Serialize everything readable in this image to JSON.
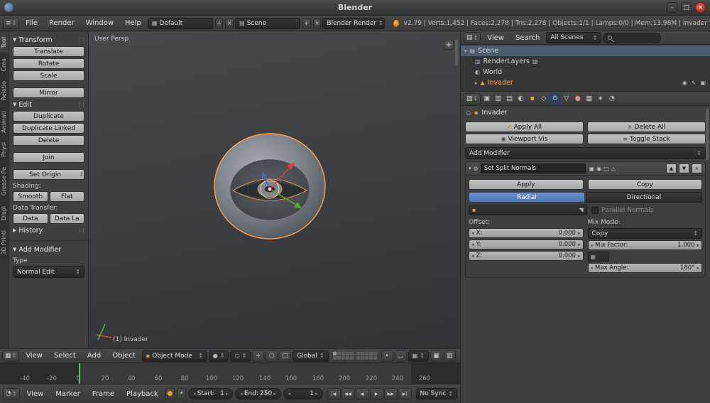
{
  "icons": {
    "app": "●",
    "minus": "–",
    "square": "□",
    "x": "×",
    "plus": "+",
    "menu": "≡",
    "up_down": "↕",
    "grid": "▦",
    "hgrid": "▤",
    "vgrid": "▥",
    "diag": "▧",
    "dot": "●",
    "sdot": "•",
    "circle": "○",
    "half_circle": "◐",
    "quarter_circle": "◔",
    "arc": "◡",
    "cube": "▪",
    "tri_up": "▲",
    "tri_down": "▼",
    "tri_right": "▶",
    "tri_down_s": "▾",
    "tri_right_s": "▸",
    "left_s": "◂",
    "right_s": "▸",
    "gear": "⚙",
    "eye": "◉",
    "check": "✓",
    "grip": "⋮⋮",
    "corner": "◥",
    "nw_arrow": "↖",
    "tri_hollow": "△",
    "camera": "▣",
    "jump_start": "|◀",
    "prev_key": "◀◀",
    "play_rev": "◀",
    "play": "▶",
    "next_key": "▶▶",
    "jump_end": "▶|"
  },
  "titlebar": {
    "title": "Blender"
  },
  "menubar": {
    "menus": [
      "File",
      "Render",
      "Window",
      "Help"
    ],
    "layout": {
      "value": "Default"
    },
    "scene": {
      "value": "Scene"
    },
    "engine": "Blender Render",
    "stats": "v2.79 | Verts:1,452 | Faces:2,278 | Tris:2,278 | Objects:1/1 | Lamps:0/0 | Mem:13.98M | Invader"
  },
  "toolshelf": {
    "tabs": [
      "Tool",
      "Crea",
      "Relatio",
      "Animati",
      "Physi",
      "Grease Pe",
      "Displ",
      "3D Printi"
    ],
    "transform_title": "Transform",
    "translate": "Translate",
    "rotate": "Rotate",
    "scale": "Scale",
    "mirror": "Mirror",
    "edit_title": "Edit",
    "duplicate": "Duplicate",
    "duplicate_linked": "Duplicate Linked",
    "delete": "Delete",
    "join": "Join",
    "set_origin": "Set Origin",
    "shading_label": "Shading:",
    "smooth": "Smooth",
    "flat": "Flat",
    "data_transfer_label": "Data Transfer:",
    "data": "Data",
    "data_la": "Data La",
    "history_title": "History",
    "operator_title": "Add Modifier",
    "type_label": "Type",
    "type_value": "Normal Edit"
  },
  "viewport": {
    "view_label": "User Persp",
    "object_label": "(1) Invader",
    "header": {
      "menus": [
        "View",
        "Select",
        "Add",
        "Object"
      ],
      "mode": "Object Mode",
      "orientation": "Global"
    }
  },
  "timeline": {
    "ticks": [
      "-40",
      "-20",
      "0",
      "20",
      "40",
      "60",
      "80",
      "100",
      "120",
      "140",
      "160",
      "180",
      "200",
      "220",
      "240",
      "260"
    ],
    "footer": {
      "menus": [
        "View",
        "Marker",
        "Frame",
        "Playback"
      ],
      "start_label": "Start:",
      "start_value": "1",
      "end_label": "End:",
      "end_value": "250",
      "frame_value": "1",
      "sync": "No Sync"
    }
  },
  "outliner": {
    "header": {
      "view": "View",
      "search": "Search",
      "display": "All Scenes"
    },
    "rows": {
      "scene": "Scene",
      "renderlayers": "RenderLayers",
      "world": "World",
      "invader": "Invader"
    }
  },
  "properties": {
    "tab_glyphs": [
      "▣",
      "▥",
      "▤",
      "◐",
      "▪",
      "◇",
      "⚙",
      "▽",
      "●",
      "▦",
      "∗",
      "◔"
    ],
    "breadcrumb": "Invader",
    "apply_all": "Apply All",
    "delete_all": "Delete All",
    "viewport_vis": "Viewport Vis",
    "toggle_stack": "Toggle Stack",
    "add_modifier": "Add Modifier",
    "modifier": {
      "name": "Set Split Normals",
      "apply": "Apply",
      "copy": "Copy",
      "radial": "Radial",
      "directional": "Directional",
      "parallel_normals": "Parallel Normals",
      "offset_label": "Offset:",
      "mix_mode_label": "Mix Mode:",
      "offset_x_label": "X:",
      "offset_x": "0.000",
      "offset_y_label": "Y:",
      "offset_y": "0.000",
      "offset_z_label": "Z:",
      "offset_z": "0.000",
      "mix_mode": "Copy",
      "mix_factor_label": "Mix Factor:",
      "mix_factor": "1.000",
      "max_angle_label": "Max Angle:",
      "max_angle": "180°"
    }
  }
}
